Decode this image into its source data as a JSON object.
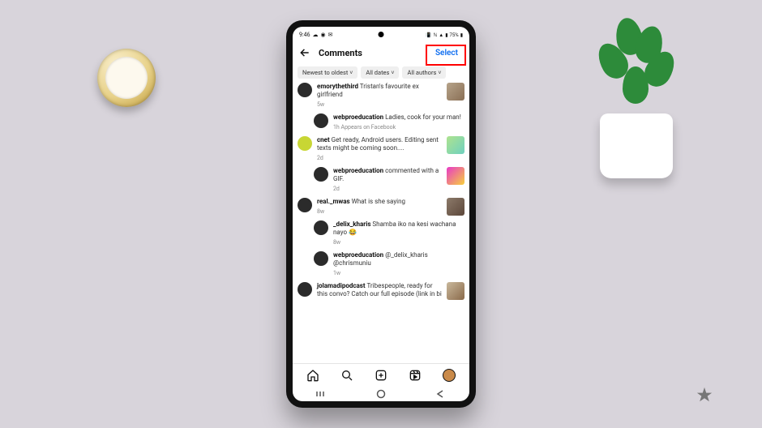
{
  "statusbar": {
    "time": "9:46",
    "battery_text": "75%"
  },
  "header": {
    "title": "Comments",
    "select_label": "Select"
  },
  "filters": {
    "sort": "Newest to oldest",
    "dates": "All dates",
    "authors": "All authors"
  },
  "comments": [
    {
      "user": "emorythethird",
      "text": "Tristan's favourite ex girlfriend",
      "meta": "5w",
      "avatar": "dark",
      "thumb": "t1",
      "reply": false
    },
    {
      "user": "webproeducation",
      "text": "Ladies, cook for your man!",
      "meta": "1h   Appears on Facebook",
      "avatar": "dark ring",
      "thumb": "",
      "reply": true
    },
    {
      "user": "cnet",
      "text": "Get ready, Android users. Editing sent texts might be coming soon....",
      "meta": "2d",
      "avatar": "green",
      "thumb": "t2",
      "reply": false
    },
    {
      "user": "webproeducation",
      "text": "commented with a GIF.",
      "meta": "2d",
      "avatar": "dark ring",
      "thumb": "t3",
      "reply": true
    },
    {
      "user": "real._mwas",
      "text": "What is she saying",
      "meta": "8w",
      "avatar": "dark",
      "thumb": "t4",
      "reply": false
    },
    {
      "user": "_delix_kharis",
      "text": "Shamba iko na kesi wachana nayo 😂",
      "meta": "8w",
      "avatar": "dark ring",
      "thumb": "",
      "reply": true
    },
    {
      "user": "webproeducation",
      "text": "@_delix_kharis @chrismuniu",
      "meta": "1w",
      "avatar": "dark ring",
      "thumb": "",
      "reply": true
    },
    {
      "user": "jolamadipodcast",
      "text": "Tribespeople, ready for this convo? Catch our full episode (link in bi",
      "meta": "",
      "avatar": "dark",
      "thumb": "t5",
      "reply": false
    }
  ]
}
